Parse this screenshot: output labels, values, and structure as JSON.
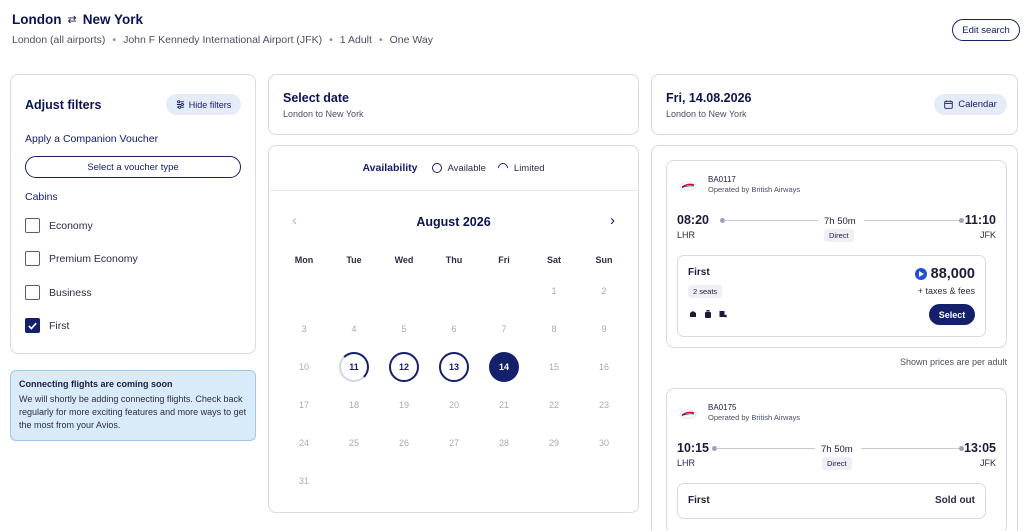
{
  "header": {
    "origin": "London",
    "swap_icon": "swap-arrows-icon",
    "destination": "New York",
    "origin_airport": "London (all airports)",
    "destination_airport": "John F Kennedy International Airport (JFK)",
    "passengers": "1 Adult",
    "trip_type": "One Way",
    "edit_button": "Edit search"
  },
  "filters": {
    "title": "Adjust filters",
    "hide_button": "Hide filters",
    "companion_label": "Apply a Companion Voucher",
    "voucher_button": "Select a voucher type",
    "cabins_label": "Cabins",
    "cabins": [
      {
        "label": "Economy",
        "checked": false
      },
      {
        "label": "Premium Economy",
        "checked": false
      },
      {
        "label": "Business",
        "checked": false
      },
      {
        "label": "First",
        "checked": true
      }
    ]
  },
  "info": {
    "title": "Connecting flights are coming soon",
    "body": "We will shortly be adding connecting flights. Check back regularly for more exciting features and more ways to get the most from your Avios."
  },
  "select_date": {
    "title": "Select date",
    "subtitle": "London to New York"
  },
  "calendar": {
    "availability_label": "Availability",
    "available_label": "Available",
    "limited_label": "Limited",
    "month": "August 2026",
    "weekdays": [
      "Mon",
      "Tue",
      "Wed",
      "Thu",
      "Fri",
      "Sat",
      "Sun"
    ],
    "first_weekday_index": 5,
    "days_in_month": 31,
    "limited_days": [
      11
    ],
    "available_days": [
      12,
      13
    ],
    "selected_day": 14
  },
  "date_header": {
    "title": "Fri, 14.08.2026",
    "subtitle": "London to New York",
    "calendar_button": "Calendar"
  },
  "flights": [
    {
      "number": "BA0117",
      "operated_by": "Operated by British Airways",
      "depart_time": "08:20",
      "depart_airport": "LHR",
      "duration": "7h 50m",
      "stops": "Direct",
      "arrive_time": "11:10",
      "arrive_airport": "JFK",
      "cabin": "First",
      "seats": "2 seats",
      "price": "88,000",
      "taxes": "+ taxes & fees",
      "select_label": "Select"
    },
    {
      "number": "BA0175",
      "operated_by": "Operated by British Airways",
      "depart_time": "10:15",
      "depart_airport": "LHR",
      "duration": "7h 50m",
      "stops": "Direct",
      "arrive_time": "13:05",
      "arrive_airport": "JFK",
      "cabin": "First",
      "status": "Sold out"
    }
  ],
  "per_adult_note": "Shown prices are per adult"
}
